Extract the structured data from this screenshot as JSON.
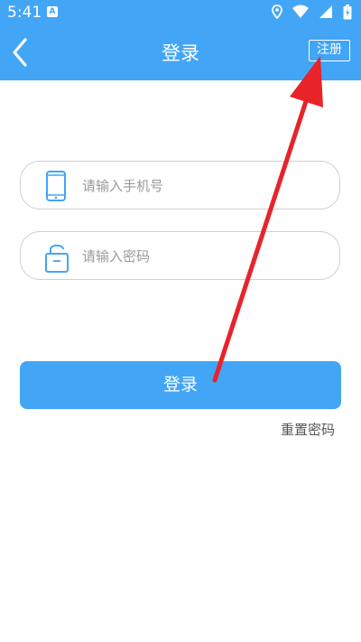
{
  "status_bar": {
    "time": "5:41",
    "notification_glyph": "A"
  },
  "header": {
    "back_icon": "chevron-left-icon",
    "title": "登录",
    "register_label": "注册"
  },
  "form": {
    "phone": {
      "placeholder": "请输入手机号",
      "value": "",
      "icon": "phone-icon"
    },
    "password": {
      "placeholder": "请输入密码",
      "value": "",
      "icon": "lock-icon"
    }
  },
  "login_button": {
    "label": "登录"
  },
  "reset_link": {
    "label": "重置密码"
  },
  "colors": {
    "primary": "#43A5F5",
    "annotation_arrow": "#E8232A",
    "border": "#cfcfcf"
  }
}
